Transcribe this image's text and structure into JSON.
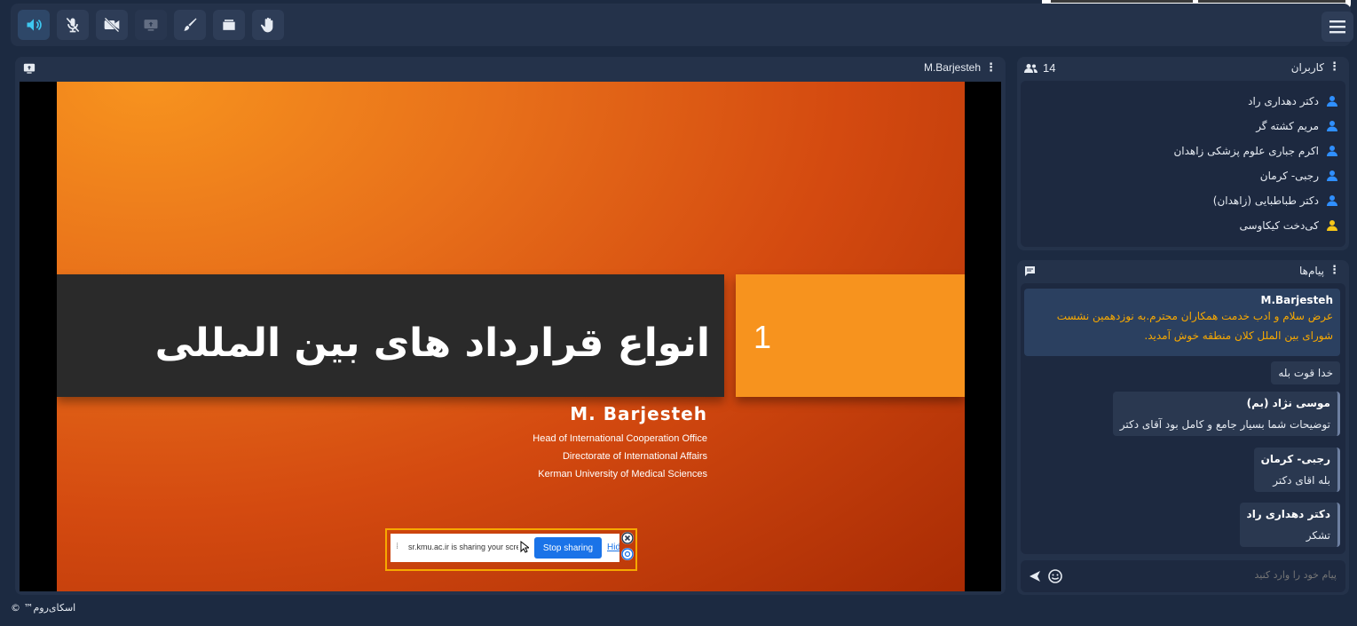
{
  "toolbar": {
    "buttons": [
      {
        "name": "speaker-button",
        "icon": "speaker-icon",
        "state": "active"
      },
      {
        "name": "mic-button",
        "icon": "mic-off-icon",
        "state": "off"
      },
      {
        "name": "camera-button",
        "icon": "camera-off-icon",
        "state": "off"
      },
      {
        "name": "share-screen-button",
        "icon": "screen-share-icon",
        "state": "disabled"
      },
      {
        "name": "brush-button",
        "icon": "brush-icon",
        "state": "normal"
      },
      {
        "name": "files-button",
        "icon": "folder-icon",
        "state": "normal"
      },
      {
        "name": "raise-hand-button",
        "icon": "hand-icon",
        "state": "normal"
      }
    ],
    "menu_icon": "hamburger-icon"
  },
  "presentation": {
    "presenter": "M.Barjesteh",
    "slide": {
      "number": "1",
      "title": "انواع قرارداد های بین المللی",
      "author": "M. Barjesteh",
      "affiliations": [
        "Head of International Cooperation Office",
        "Directorate of International Affairs",
        "Kerman University of Medical Sciences"
      ]
    },
    "share_bar": {
      "text": "sr.kmu.ac.ir is sharing your screen.",
      "stop_label": "Stop sharing",
      "hide_label": "Hide"
    }
  },
  "users": {
    "title": "کاربران",
    "count": "14",
    "list": [
      {
        "name": "دکتر دهداری راد",
        "color": "#2f8fff"
      },
      {
        "name": "مریم کشته گر",
        "color": "#2f8fff"
      },
      {
        "name": "اکرم جباری علوم پزشکی زاهدان",
        "color": "#2f8fff"
      },
      {
        "name": "رجبی- کرمان",
        "color": "#2f8fff"
      },
      {
        "name": "دکتر طباطبایی (زاهدان)",
        "color": "#2f8fff"
      },
      {
        "name": "کی‌دخت کیکاوسی",
        "color": "#f5c518"
      }
    ]
  },
  "messages": {
    "title": "پیام‌ها",
    "highlight": {
      "sender": "M.Barjesteh",
      "line1": "عرض سلام و ادب خدمت همکاران محترم.به نوزدهمین نشست",
      "line2": "شورای بین الملل کلان منطقه خوش آمدید."
    },
    "items": [
      {
        "sender": "",
        "text": "خدا قوت بله"
      },
      {
        "sender": "موسی نژاد (بم)",
        "text": "توضیحات شما بسیار جامع و کامل بود آقای دکتر"
      },
      {
        "sender": "رجبی- کرمان",
        "text": "بله اقای دکتر"
      },
      {
        "sender": "دکتر دهداری راد",
        "text": "تشکر"
      }
    ],
    "input_placeholder": "پیام خود را وارد کنید"
  },
  "footer": {
    "brand": "اسکای‌روم™ ©"
  },
  "colors": {
    "accent": "#f7a800",
    "panel": "#24324a",
    "background": "#1c2a41"
  }
}
